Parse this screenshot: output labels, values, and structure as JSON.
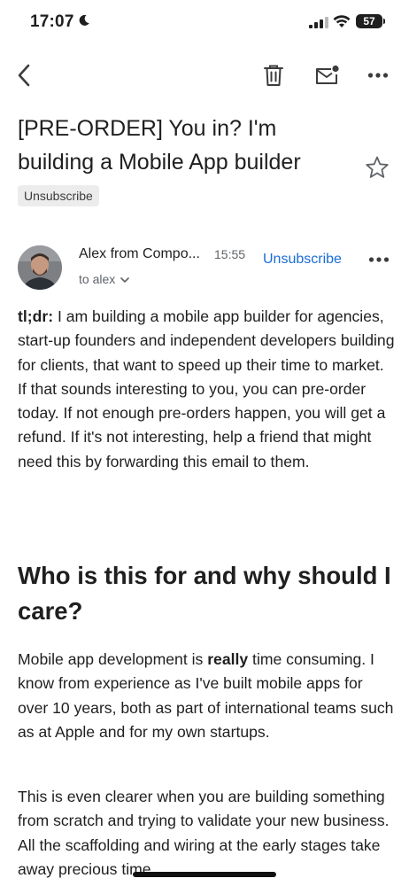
{
  "status_bar": {
    "time": "17:07",
    "battery": "57"
  },
  "toolbar": {
    "back_icon": "chevron-left-icon",
    "delete_icon": "trash-icon",
    "unread_icon": "mail-unread-icon",
    "more_icon": "more-horizontal-icon"
  },
  "email": {
    "subject": "[PRE-ORDER] You in? I'm building a Mobile App builder",
    "label": "Unsubscribe",
    "sender": "Alex from Compo...",
    "time": "15:55",
    "to": "to alex",
    "unsubscribe_link": "Unsubscribe",
    "tldr_label": "tl;dr:",
    "tldr_text": " I am building a mobile app builder for agencies, start-up founders and independent developers building for clients, that want to speed up their time to market. If that sounds interesting to you, you can pre-order today. If not enough pre-orders happen, you will get a refund. If it's not interesting, help a friend that might need this by forwarding this email to them.",
    "heading": "Who is this for and why should I care?",
    "p2_before": "Mobile app development is ",
    "p2_bold": "really",
    "p2_after": " time consuming. I know from experience as I've built mobile apps for over 10 years, both as part of international teams such as at Apple and for my own startups.",
    "p3": "This is even clearer when you are building something from scratch and trying to validate your new business. All the scaffolding and wiring at the early stages take away precious time."
  },
  "colors": {
    "link": "#1a6dd6",
    "chip_bg": "#ececec"
  }
}
